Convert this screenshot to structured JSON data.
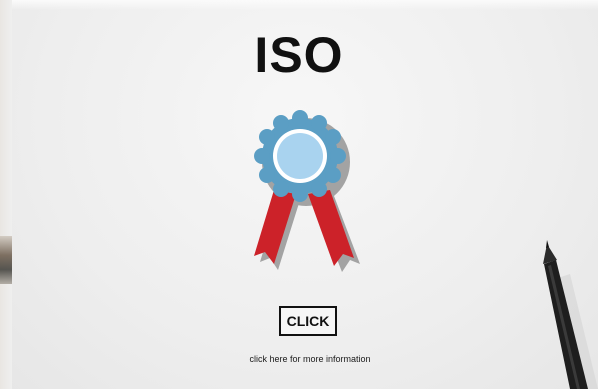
{
  "title": "ISO",
  "icons": {
    "badge": "award-ribbon-icon",
    "pen": "marker-pen"
  },
  "colors": {
    "rosette_outer": "#5b9ec4",
    "rosette_inner": "#a9d3ef",
    "ribbon": "#cc2229",
    "shadow": "#9d9d9d"
  },
  "button": {
    "label": "CLICK"
  },
  "info": {
    "text": "click here for more information"
  }
}
